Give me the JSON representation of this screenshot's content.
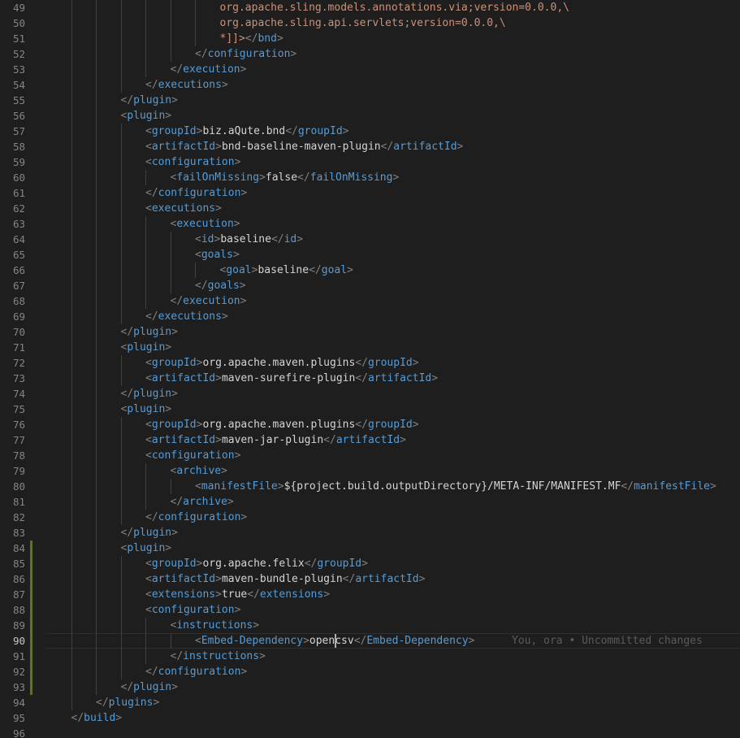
{
  "editor": {
    "current_line": 90,
    "blame_text": "You, ora • Uncommitted changes",
    "modified_lines": [
      84,
      85,
      86,
      87,
      88,
      89,
      90,
      91,
      92,
      93
    ],
    "colors": {
      "background": "#1e1e1e",
      "tag": "#569cd6",
      "bracket": "#808080",
      "text": "#d4d4d4",
      "string": "#ce9178",
      "line_number": "#858585",
      "modified_marker": "#587c0c"
    },
    "lines": [
      {
        "n": "49",
        "indent": 7,
        "tokens": [
          [
            "string",
            "org.apache.sling.models.annotations.via;version=0.0.0,\\"
          ]
        ]
      },
      {
        "n": "50",
        "indent": 7,
        "tokens": [
          [
            "string",
            "org.apache.sling.api.servlets;version=0.0.0,\\"
          ]
        ]
      },
      {
        "n": "51",
        "indent": 7,
        "tokens": [
          [
            "string",
            "*]]>"
          ],
          [
            "bracket",
            "</"
          ],
          [
            "tag",
            "bnd"
          ],
          [
            "bracket",
            ">"
          ]
        ]
      },
      {
        "n": "52",
        "indent": 6,
        "tokens": [
          [
            "bracket",
            "</"
          ],
          [
            "tag",
            "configuration"
          ],
          [
            "bracket",
            ">"
          ]
        ]
      },
      {
        "n": "53",
        "indent": 5,
        "tokens": [
          [
            "bracket",
            "</"
          ],
          [
            "tag",
            "execution"
          ],
          [
            "bracket",
            ">"
          ]
        ]
      },
      {
        "n": "54",
        "indent": 4,
        "tokens": [
          [
            "bracket",
            "</"
          ],
          [
            "tag",
            "executions"
          ],
          [
            "bracket",
            ">"
          ]
        ]
      },
      {
        "n": "55",
        "indent": 3,
        "tokens": [
          [
            "bracket",
            "</"
          ],
          [
            "tag",
            "plugin"
          ],
          [
            "bracket",
            ">"
          ]
        ]
      },
      {
        "n": "56",
        "indent": 3,
        "tokens": [
          [
            "bracket",
            "<"
          ],
          [
            "tag",
            "plugin"
          ],
          [
            "bracket",
            ">"
          ]
        ]
      },
      {
        "n": "57",
        "indent": 4,
        "tokens": [
          [
            "bracket",
            "<"
          ],
          [
            "tag",
            "groupId"
          ],
          [
            "bracket",
            ">"
          ],
          [
            "text",
            "biz.aQute.bnd"
          ],
          [
            "bracket",
            "</"
          ],
          [
            "tag",
            "groupId"
          ],
          [
            "bracket",
            ">"
          ]
        ]
      },
      {
        "n": "58",
        "indent": 4,
        "tokens": [
          [
            "bracket",
            "<"
          ],
          [
            "tag",
            "artifactId"
          ],
          [
            "bracket",
            ">"
          ],
          [
            "text",
            "bnd-baseline-maven-plugin"
          ],
          [
            "bracket",
            "</"
          ],
          [
            "tag",
            "artifactId"
          ],
          [
            "bracket",
            ">"
          ]
        ]
      },
      {
        "n": "59",
        "indent": 4,
        "tokens": [
          [
            "bracket",
            "<"
          ],
          [
            "tag",
            "configuration"
          ],
          [
            "bracket",
            ">"
          ]
        ]
      },
      {
        "n": "60",
        "indent": 5,
        "tokens": [
          [
            "bracket",
            "<"
          ],
          [
            "tag",
            "failOnMissing"
          ],
          [
            "bracket",
            ">"
          ],
          [
            "text",
            "false"
          ],
          [
            "bracket",
            "</"
          ],
          [
            "tag",
            "failOnMissing"
          ],
          [
            "bracket",
            ">"
          ]
        ]
      },
      {
        "n": "61",
        "indent": 4,
        "tokens": [
          [
            "bracket",
            "</"
          ],
          [
            "tag",
            "configuration"
          ],
          [
            "bracket",
            ">"
          ]
        ]
      },
      {
        "n": "62",
        "indent": 4,
        "tokens": [
          [
            "bracket",
            "<"
          ],
          [
            "tag",
            "executions"
          ],
          [
            "bracket",
            ">"
          ]
        ]
      },
      {
        "n": "63",
        "indent": 5,
        "tokens": [
          [
            "bracket",
            "<"
          ],
          [
            "tag",
            "execution"
          ],
          [
            "bracket",
            ">"
          ]
        ]
      },
      {
        "n": "64",
        "indent": 6,
        "tokens": [
          [
            "bracket",
            "<"
          ],
          [
            "tag",
            "id"
          ],
          [
            "bracket",
            ">"
          ],
          [
            "text",
            "baseline"
          ],
          [
            "bracket",
            "</"
          ],
          [
            "tag",
            "id"
          ],
          [
            "bracket",
            ">"
          ]
        ]
      },
      {
        "n": "65",
        "indent": 6,
        "tokens": [
          [
            "bracket",
            "<"
          ],
          [
            "tag",
            "goals"
          ],
          [
            "bracket",
            ">"
          ]
        ]
      },
      {
        "n": "66",
        "indent": 7,
        "tokens": [
          [
            "bracket",
            "<"
          ],
          [
            "tag",
            "goal"
          ],
          [
            "bracket",
            ">"
          ],
          [
            "text",
            "baseline"
          ],
          [
            "bracket",
            "</"
          ],
          [
            "tag",
            "goal"
          ],
          [
            "bracket",
            ">"
          ]
        ]
      },
      {
        "n": "67",
        "indent": 6,
        "tokens": [
          [
            "bracket",
            "</"
          ],
          [
            "tag",
            "goals"
          ],
          [
            "bracket",
            ">"
          ]
        ]
      },
      {
        "n": "68",
        "indent": 5,
        "tokens": [
          [
            "bracket",
            "</"
          ],
          [
            "tag",
            "execution"
          ],
          [
            "bracket",
            ">"
          ]
        ]
      },
      {
        "n": "69",
        "indent": 4,
        "tokens": [
          [
            "bracket",
            "</"
          ],
          [
            "tag",
            "executions"
          ],
          [
            "bracket",
            ">"
          ]
        ]
      },
      {
        "n": "70",
        "indent": 3,
        "tokens": [
          [
            "bracket",
            "</"
          ],
          [
            "tag",
            "plugin"
          ],
          [
            "bracket",
            ">"
          ]
        ]
      },
      {
        "n": "71",
        "indent": 3,
        "tokens": [
          [
            "bracket",
            "<"
          ],
          [
            "tag",
            "plugin"
          ],
          [
            "bracket",
            ">"
          ]
        ]
      },
      {
        "n": "72",
        "indent": 4,
        "tokens": [
          [
            "bracket",
            "<"
          ],
          [
            "tag",
            "groupId"
          ],
          [
            "bracket",
            ">"
          ],
          [
            "text",
            "org.apache.maven.plugins"
          ],
          [
            "bracket",
            "</"
          ],
          [
            "tag",
            "groupId"
          ],
          [
            "bracket",
            ">"
          ]
        ]
      },
      {
        "n": "73",
        "indent": 4,
        "tokens": [
          [
            "bracket",
            "<"
          ],
          [
            "tag",
            "artifactId"
          ],
          [
            "bracket",
            ">"
          ],
          [
            "text",
            "maven-surefire-plugin"
          ],
          [
            "bracket",
            "</"
          ],
          [
            "tag",
            "artifactId"
          ],
          [
            "bracket",
            ">"
          ]
        ]
      },
      {
        "n": "74",
        "indent": 3,
        "tokens": [
          [
            "bracket",
            "</"
          ],
          [
            "tag",
            "plugin"
          ],
          [
            "bracket",
            ">"
          ]
        ]
      },
      {
        "n": "75",
        "indent": 3,
        "tokens": [
          [
            "bracket",
            "<"
          ],
          [
            "tag",
            "plugin"
          ],
          [
            "bracket",
            ">"
          ]
        ]
      },
      {
        "n": "76",
        "indent": 4,
        "tokens": [
          [
            "bracket",
            "<"
          ],
          [
            "tag",
            "groupId"
          ],
          [
            "bracket",
            ">"
          ],
          [
            "text",
            "org.apache.maven.plugins"
          ],
          [
            "bracket",
            "</"
          ],
          [
            "tag",
            "groupId"
          ],
          [
            "bracket",
            ">"
          ]
        ]
      },
      {
        "n": "77",
        "indent": 4,
        "tokens": [
          [
            "bracket",
            "<"
          ],
          [
            "tag",
            "artifactId"
          ],
          [
            "bracket",
            ">"
          ],
          [
            "text",
            "maven-jar-plugin"
          ],
          [
            "bracket",
            "</"
          ],
          [
            "tag",
            "artifactId"
          ],
          [
            "bracket",
            ">"
          ]
        ]
      },
      {
        "n": "78",
        "indent": 4,
        "tokens": [
          [
            "bracket",
            "<"
          ],
          [
            "tag",
            "configuration"
          ],
          [
            "bracket",
            ">"
          ]
        ]
      },
      {
        "n": "79",
        "indent": 5,
        "tokens": [
          [
            "bracket",
            "<"
          ],
          [
            "tag",
            "archive"
          ],
          [
            "bracket",
            ">"
          ]
        ]
      },
      {
        "n": "80",
        "indent": 6,
        "tokens": [
          [
            "bracket",
            "<"
          ],
          [
            "tag",
            "manifestFile"
          ],
          [
            "bracket",
            ">"
          ],
          [
            "text",
            "${project.build.outputDirectory}/META-INF/MANIFEST.MF"
          ],
          [
            "bracket",
            "</"
          ],
          [
            "tag",
            "manifestFile"
          ],
          [
            "bracket",
            ">"
          ]
        ]
      },
      {
        "n": "81",
        "indent": 5,
        "tokens": [
          [
            "bracket",
            "</"
          ],
          [
            "tag",
            "archive"
          ],
          [
            "bracket",
            ">"
          ]
        ]
      },
      {
        "n": "82",
        "indent": 4,
        "tokens": [
          [
            "bracket",
            "</"
          ],
          [
            "tag",
            "configuration"
          ],
          [
            "bracket",
            ">"
          ]
        ]
      },
      {
        "n": "83",
        "indent": 3,
        "tokens": [
          [
            "bracket",
            "</"
          ],
          [
            "tag",
            "plugin"
          ],
          [
            "bracket",
            ">"
          ]
        ]
      },
      {
        "n": "84",
        "indent": 3,
        "tokens": [
          [
            "bracket",
            "<"
          ],
          [
            "tag",
            "plugin"
          ],
          [
            "bracket",
            ">"
          ]
        ]
      },
      {
        "n": "85",
        "indent": 4,
        "tokens": [
          [
            "bracket",
            "<"
          ],
          [
            "tag",
            "groupId"
          ],
          [
            "bracket",
            ">"
          ],
          [
            "text",
            "org.apache.felix"
          ],
          [
            "bracket",
            "</"
          ],
          [
            "tag",
            "groupId"
          ],
          [
            "bracket",
            ">"
          ]
        ]
      },
      {
        "n": "86",
        "indent": 4,
        "tokens": [
          [
            "bracket",
            "<"
          ],
          [
            "tag",
            "artifactId"
          ],
          [
            "bracket",
            ">"
          ],
          [
            "text",
            "maven-bundle-plugin"
          ],
          [
            "bracket",
            "</"
          ],
          [
            "tag",
            "artifactId"
          ],
          [
            "bracket",
            ">"
          ]
        ]
      },
      {
        "n": "87",
        "indent": 4,
        "tokens": [
          [
            "bracket",
            "<"
          ],
          [
            "tag",
            "extensions"
          ],
          [
            "bracket",
            ">"
          ],
          [
            "text",
            "true"
          ],
          [
            "bracket",
            "</"
          ],
          [
            "tag",
            "extensions"
          ],
          [
            "bracket",
            ">"
          ]
        ]
      },
      {
        "n": "88",
        "indent": 4,
        "tokens": [
          [
            "bracket",
            "<"
          ],
          [
            "tag",
            "configuration"
          ],
          [
            "bracket",
            ">"
          ]
        ]
      },
      {
        "n": "89",
        "indent": 5,
        "tokens": [
          [
            "bracket",
            "<"
          ],
          [
            "tag",
            "instructions"
          ],
          [
            "bracket",
            ">"
          ]
        ]
      },
      {
        "n": "90",
        "indent": 6,
        "tokens": [
          [
            "bracket",
            "<"
          ],
          [
            "tag",
            "Embed-Dependency"
          ],
          [
            "bracket",
            ">"
          ],
          [
            "text",
            "opencsv"
          ],
          [
            "bracket",
            "</"
          ],
          [
            "tag",
            "Embed-Dependency"
          ],
          [
            "bracket",
            ">"
          ]
        ]
      },
      {
        "n": "91",
        "indent": 5,
        "tokens": [
          [
            "bracket",
            "</"
          ],
          [
            "tag",
            "instructions"
          ],
          [
            "bracket",
            ">"
          ]
        ]
      },
      {
        "n": "92",
        "indent": 4,
        "tokens": [
          [
            "bracket",
            "</"
          ],
          [
            "tag",
            "configuration"
          ],
          [
            "bracket",
            ">"
          ]
        ]
      },
      {
        "n": "93",
        "indent": 3,
        "tokens": [
          [
            "bracket",
            "</"
          ],
          [
            "tag",
            "plugin"
          ],
          [
            "bracket",
            ">"
          ]
        ]
      },
      {
        "n": "94",
        "indent": 2,
        "tokens": [
          [
            "bracket",
            "</"
          ],
          [
            "tag",
            "plugins"
          ],
          [
            "bracket",
            ">"
          ]
        ]
      },
      {
        "n": "95",
        "indent": 1,
        "tokens": [
          [
            "bracket",
            "</"
          ],
          [
            "tag",
            "build"
          ],
          [
            "bracket",
            ">"
          ]
        ]
      },
      {
        "n": "96",
        "indent": 0,
        "tokens": []
      }
    ]
  }
}
